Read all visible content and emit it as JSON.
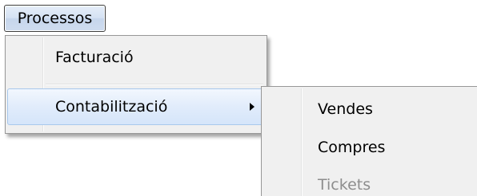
{
  "menubar": {
    "processos_label": "Processos"
  },
  "dropdown": {
    "items": [
      {
        "label": "Facturació",
        "has_submenu": false
      },
      {
        "label": "Contabilització",
        "has_submenu": true,
        "highlighted": true
      }
    ]
  },
  "submenu": {
    "items": [
      {
        "label": "Vendes",
        "enabled": true
      },
      {
        "label": "Compres",
        "enabled": true
      },
      {
        "label": "Tickets",
        "enabled": false
      }
    ]
  },
  "icons": {
    "submenu_arrow": "chevron-right-icon"
  },
  "colors": {
    "menu_background": "#f0f0f0",
    "highlight_border": "#a8c8ec",
    "highlight_fill": "#e1ecfb",
    "disabled_text": "#8d8d8d"
  }
}
